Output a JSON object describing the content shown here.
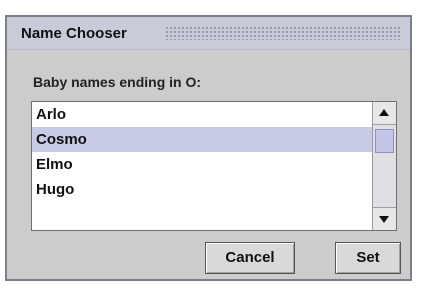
{
  "window": {
    "title": "Name Chooser"
  },
  "prompt": {
    "label": "Baby names ending in O:"
  },
  "list": {
    "items": [
      "Arlo",
      "Cosmo",
      "Elmo",
      "Hugo"
    ],
    "selected": "Cosmo"
  },
  "buttons": {
    "cancel_label": "Cancel",
    "set_label": "Set"
  },
  "colors": {
    "titlebar": "#c9cbd9",
    "selection": "#c8cbe6",
    "dialog_bg": "#cccccc"
  }
}
